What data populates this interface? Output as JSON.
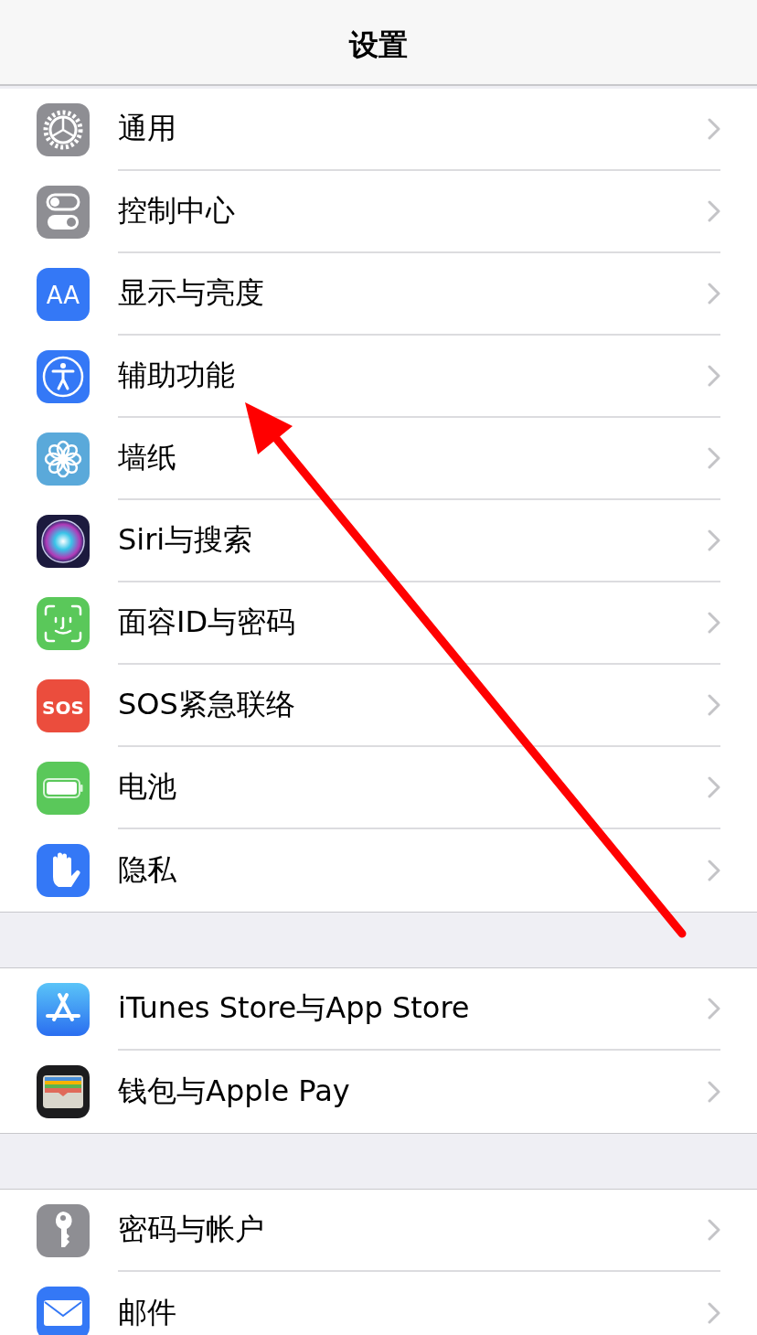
{
  "header": {
    "title": "设置"
  },
  "groups": [
    {
      "rows": [
        {
          "label": "通用"
        },
        {
          "label": "控制中心"
        },
        {
          "label": "显示与亮度",
          "icon_text": "AA"
        },
        {
          "label": "辅助功能"
        },
        {
          "label": "墙纸"
        },
        {
          "label": "Siri与搜索"
        },
        {
          "label": "面容ID与密码"
        },
        {
          "label": "SOS紧急联络",
          "icon_text": "SOS"
        },
        {
          "label": "电池"
        },
        {
          "label": "隐私"
        }
      ]
    },
    {
      "rows": [
        {
          "label": "iTunes Store与App Store"
        },
        {
          "label": "钱包与Apple Pay"
        }
      ]
    },
    {
      "rows": [
        {
          "label": "密码与帐户"
        },
        {
          "label": "邮件"
        }
      ]
    }
  ]
}
